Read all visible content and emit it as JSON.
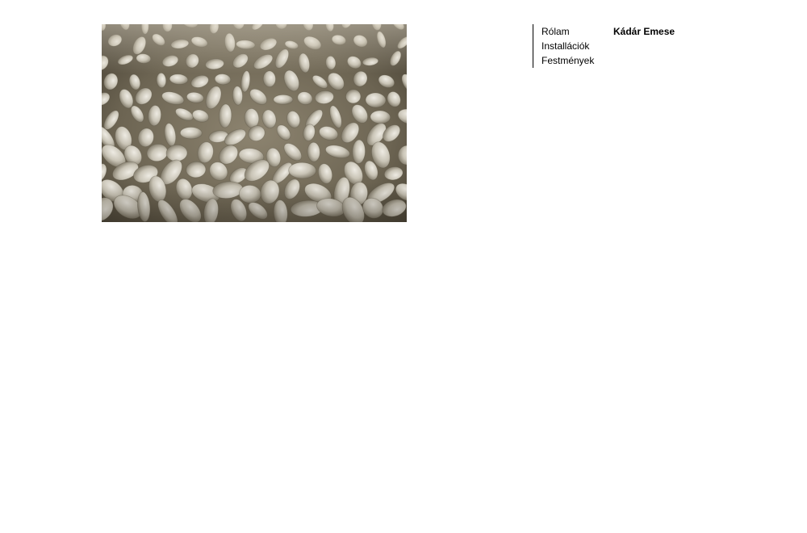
{
  "nav": {
    "items": [
      {
        "label": "Rólam"
      },
      {
        "label": "Installációk"
      },
      {
        "label": "Festmények"
      }
    ]
  },
  "site": {
    "name": "Kádár Emese"
  },
  "photo": {
    "subject": "white-clay-pellets"
  },
  "colors": {
    "background": "#ffffff",
    "text": "#000000",
    "photo_base": "#b8ab93"
  }
}
